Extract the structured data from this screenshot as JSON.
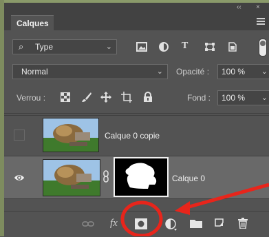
{
  "window": {
    "collapse_glyph": "‹‹",
    "close_glyph": "×"
  },
  "panel": {
    "tab_title": "Calques",
    "menu_icon": "hamburger-menu-icon"
  },
  "filter": {
    "search_icon": "search-icon",
    "kind_label": "Type",
    "filter_icons": [
      "image-filter-icon",
      "adjustment-filter-icon",
      "text-filter-icon",
      "shape-filter-icon",
      "smart-object-filter-icon"
    ],
    "toggle": "filter-toggle"
  },
  "blend": {
    "mode": "Normal",
    "opacity_label": "Opacité :",
    "opacity_value": "100 %"
  },
  "lock": {
    "label": "Verrou :",
    "icons": [
      "lock-transparency-icon",
      "lock-image-icon",
      "lock-position-icon",
      "lock-artboard-icon",
      "lock-all-icon"
    ],
    "fill_label": "Fond :",
    "fill_value": "100 %"
  },
  "layers": [
    {
      "name": "Calque 0 copie",
      "visible": false,
      "selected": false,
      "has_mask": false
    },
    {
      "name": "Calque 0",
      "visible": true,
      "selected": true,
      "has_mask": true
    }
  ],
  "bottom_icons": [
    "link-icon",
    "fx-icon",
    "add-mask-icon",
    "adjustment-layer-icon",
    "group-folder-icon",
    "new-layer-icon",
    "trash-icon"
  ],
  "bottom_fx_label": "fx",
  "annotation": {
    "circle_color": "#e8251b",
    "arrow_color": "#e8251b"
  }
}
